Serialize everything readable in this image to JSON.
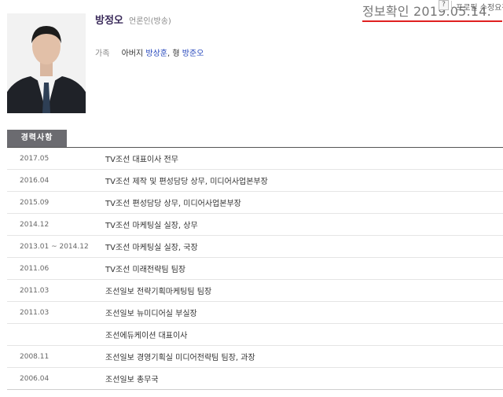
{
  "header": {
    "info_confirmed": "정보확인 2019.05.14.",
    "help": "?",
    "profile_edit": "프로필 수정요청"
  },
  "profile": {
    "name": "방정오",
    "occupation": "언론인(방송)",
    "family_label": "가족",
    "family_father_prefix": "아버지",
    "father": "방상훈",
    "family_brother_prefix": "형",
    "brother": "방준오"
  },
  "career": {
    "tab_label": "경력사항",
    "rows": [
      {
        "date": "2017.05",
        "desc": "TV조선 대표이사 전무"
      },
      {
        "date": "2016.04",
        "desc": "TV조선 제작 및 편성담당 상무, 미디어사업본부장"
      },
      {
        "date": "2015.09",
        "desc": "TV조선 편성담당 상무, 미디어사업본부장"
      },
      {
        "date": "2014.12",
        "desc": "TV조선 마케팅실 실장, 상무"
      },
      {
        "date": "2013.01 ~ 2014.12",
        "desc": "TV조선 마케팅실 실장, 국장"
      },
      {
        "date": "2011.06",
        "desc": "TV조선 미래전략팀 팀장"
      },
      {
        "date": "2011.03",
        "desc": "조선일보 전략기획마케팅팀 팀장"
      },
      {
        "date": "2011.03",
        "desc": "조선일보 뉴미디어실 부실장"
      },
      {
        "date": "",
        "desc": "조선에듀케이션 대표이사"
      },
      {
        "date": "2008.11",
        "desc": "조선일보 경영기획실 미디어전략팀 팀장, 과장"
      },
      {
        "date": "2006.04",
        "desc": "조선일보 총무국"
      }
    ]
  }
}
